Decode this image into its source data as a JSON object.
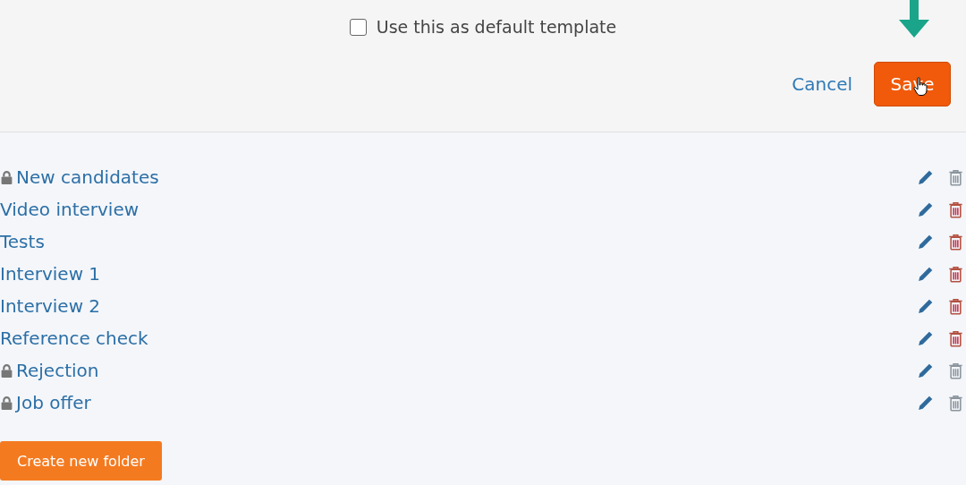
{
  "template_form": {
    "default_checkbox": {
      "label": "Use this as default template",
      "checked": false
    },
    "cancel_link": "Cancel",
    "save_button": "Save"
  },
  "folders": [
    {
      "name": "New candidates",
      "locked": true
    },
    {
      "name": "Video interview",
      "locked": false
    },
    {
      "name": "Tests",
      "locked": false
    },
    {
      "name": "Interview 1",
      "locked": false
    },
    {
      "name": "Interview 2",
      "locked": false
    },
    {
      "name": "Reference check",
      "locked": false
    },
    {
      "name": "Rejection",
      "locked": true
    },
    {
      "name": "Job offer",
      "locked": true
    }
  ],
  "create_button": "Create new folder"
}
